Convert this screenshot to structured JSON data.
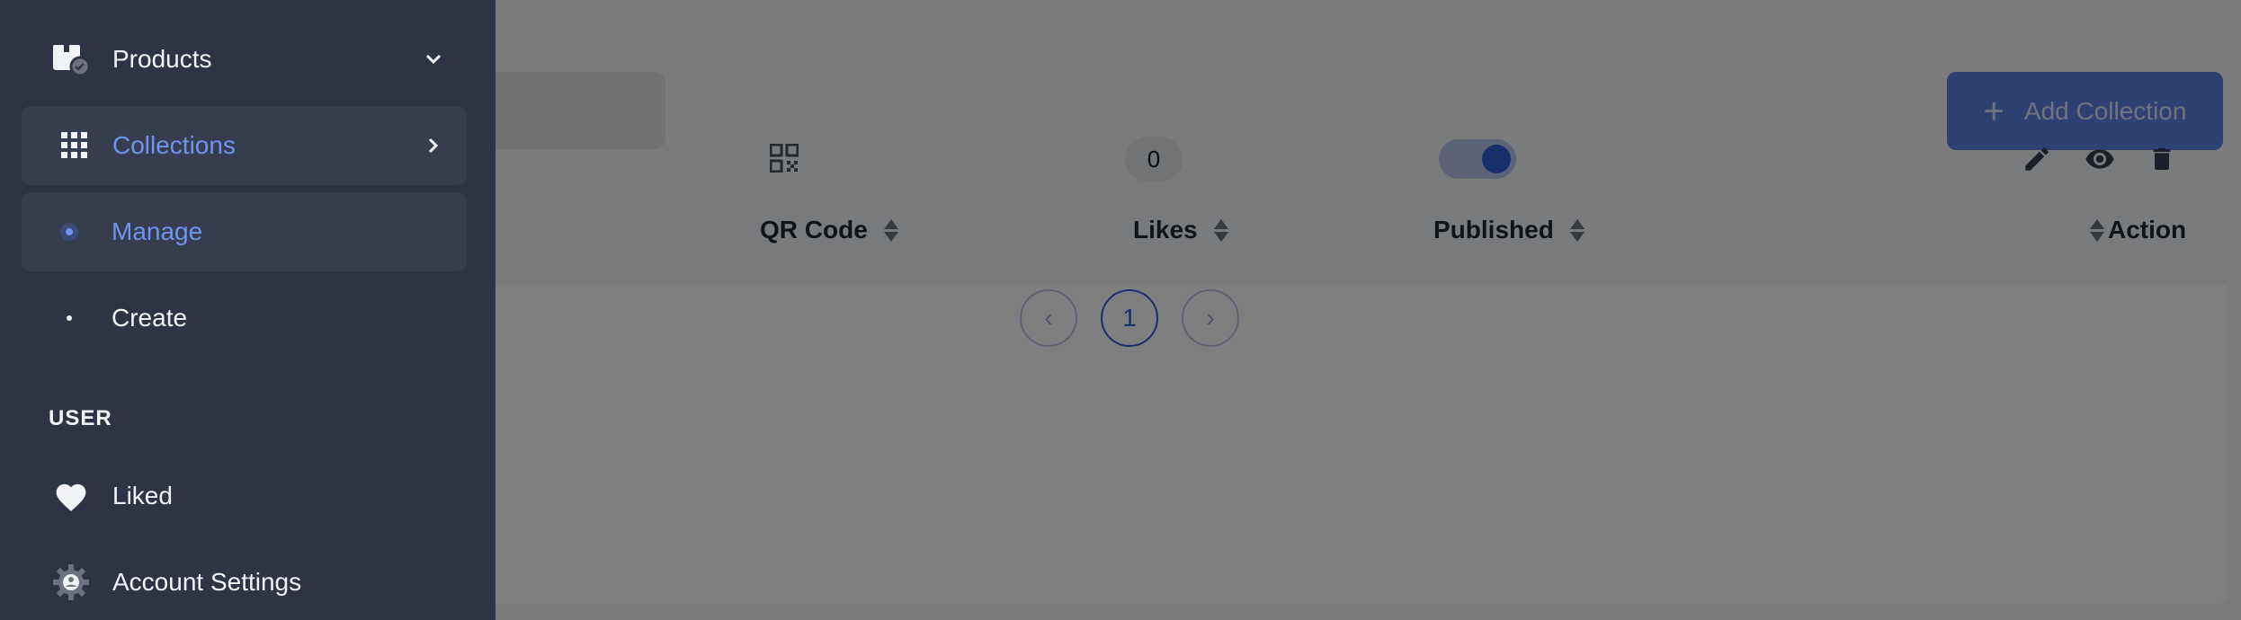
{
  "sidebar": {
    "items": [
      {
        "label": "Products",
        "icon": "products-box-icon",
        "chevron": "down"
      },
      {
        "label": "Collections",
        "icon": "grid-icon",
        "chevron": "right",
        "active": true
      },
      {
        "label": "Manage",
        "icon": "dot-icon",
        "active": true
      },
      {
        "label": "Create",
        "icon": "dot-icon"
      }
    ],
    "section_user": "USER",
    "user_items": [
      {
        "label": "Liked",
        "icon": "heart-icon"
      },
      {
        "label": "Account Settings",
        "icon": "gear-user-icon"
      }
    ]
  },
  "toolbar": {
    "add_label": "Add Collection",
    "add_icon": "+"
  },
  "table": {
    "headers": {
      "qr_code": "QR Code",
      "likes": "Likes",
      "published": "Published",
      "action": "Action"
    },
    "rows": [
      {
        "likes": "0",
        "published": true
      }
    ]
  },
  "pagination": {
    "current": "1",
    "prev": "‹",
    "next": "›"
  },
  "colors": {
    "sidebar_bg": "#2e3445",
    "accent_blue": "#6d95f0",
    "primary_button": "#5a82e6"
  }
}
